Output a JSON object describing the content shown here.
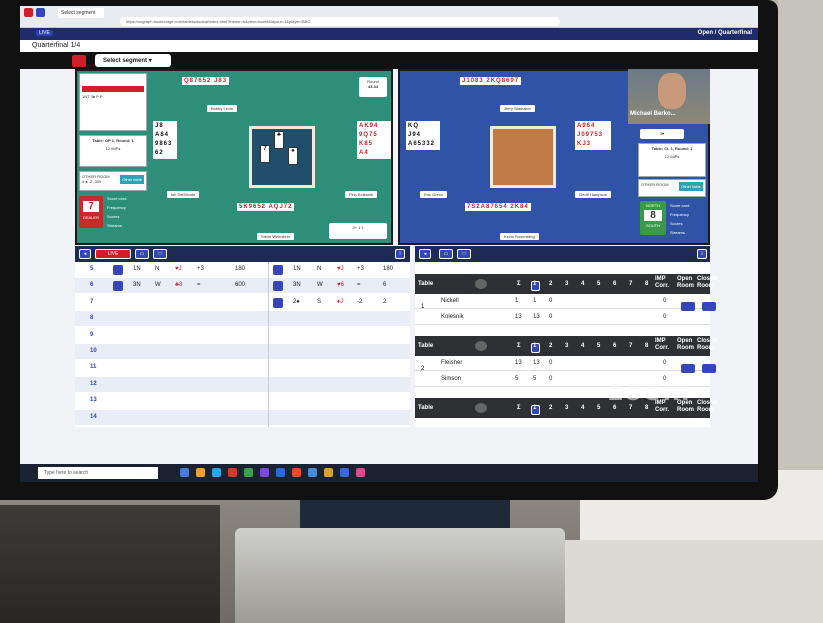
{
  "browser": {
    "tab_label": "Select segment",
    "url": "https://vugraph.bookbridge.com/tabletoolsdeal/index.html?theme=b&view=board&layout=1&player=BBO"
  },
  "topbar": {
    "live_label": "LIVE",
    "section_title": "Open / Quarterfinal",
    "event": "Quarterfinal 1/4"
  },
  "toolbar": {
    "segment_select": "Select segment"
  },
  "left_table": {
    "north_hand": "Q87652 J83",
    "north_name": "Bobby Levin",
    "west_name": "Ish Del'Monte",
    "east_name": "Finn Kolesnik",
    "south_name": "Steve Weinstein",
    "south_hand": "5K9652 AQJ72",
    "west_hand": [
      "J8",
      "A84",
      "9863",
      "62"
    ],
    "east_hand": [
      "AK94",
      "9Q75",
      "K85",
      "A4"
    ],
    "round_label": "Round",
    "round_time": "43:34",
    "table_info": "Table: OP 1, Round: 1",
    "imps": "12 IMPs",
    "other_room": "OTHER ROOM",
    "other_room_contract": "5 ♠ -2 -300",
    "other_table": "Other table",
    "dealer": "DEALER",
    "board_number": "7",
    "menu": [
      "Score card",
      "Frequency",
      "Scores",
      "Streams"
    ],
    "tricks": [
      "3+",
      "1",
      "1"
    ],
    "bid_grid": [
      "1NT",
      "3♠",
      "P",
      "P"
    ]
  },
  "right_table": {
    "north_hand": "J1083 2KQ8697",
    "north_name": "Jerry Stamatov",
    "west_name": "Eric Greco",
    "east_name": "Geoff Hampson",
    "south_name": "Kevin Rosenberg",
    "south_hand": "7S2A87654 2K84",
    "west_hand": [
      "KQ",
      "J94",
      "",
      "A65332"
    ],
    "east_hand": [
      "A964",
      "",
      "J09753",
      "KJ3"
    ],
    "table_info": "Table: CL 1, Round: 1",
    "imps": "12 IMPs",
    "other_room": "OTHER ROOM",
    "other_table": "Other table",
    "board_number": "8",
    "north_label": "NORTH",
    "south_label": "SOUTH",
    "menu": [
      "Score card",
      "Frequency",
      "Scores",
      "Streams"
    ],
    "bid": "3♥"
  },
  "video": {
    "participant": "Michael Berko..."
  },
  "boards": {
    "rows": [
      {
        "n": "5",
        "c1": "1N",
        "d1": "N",
        "s1": "♥J",
        "r1": "+3",
        "sc1": "180",
        "c2": "1N",
        "d2": "N",
        "s2": "♥J",
        "r2": "+3",
        "sc2": "180"
      },
      {
        "n": "6",
        "c1": "3N",
        "d1": "W",
        "s1": "♣8",
        "r1": "=",
        "sc1": "600",
        "c2": "3N",
        "d2": "W",
        "s2": "♥6",
        "r2": "=",
        "sc2": "6"
      },
      {
        "n": "7",
        "c1": "",
        "d1": "",
        "s1": "",
        "r1": "",
        "sc1": "",
        "c2": "2♠",
        "d2": "S",
        "s2": "♦J",
        "r2": "-2",
        "sc2": "2"
      },
      {
        "n": "8"
      },
      {
        "n": "9"
      },
      {
        "n": "10"
      },
      {
        "n": "11"
      },
      {
        "n": "12"
      },
      {
        "n": "13"
      },
      {
        "n": "14"
      }
    ]
  },
  "results": {
    "header_table": "Table",
    "header_sigma": "Σ",
    "cols": [
      "1",
      "2",
      "3",
      "4",
      "5",
      "6",
      "7",
      "8"
    ],
    "imp_corr": "IMP Corr.",
    "open_room": "Open Room",
    "closed_room": "Closed Room",
    "tables": [
      {
        "num": "1",
        "players": [
          {
            "name": "Nickell",
            "s": "1",
            "r": "1",
            "x": "0",
            "imp": "0"
          },
          {
            "name": "Kolesnik",
            "s": "13",
            "r": "13",
            "x": "0",
            "imp": "0"
          }
        ]
      },
      {
        "num": "2",
        "players": [
          {
            "name": "Fleisher",
            "s": "13",
            "r": "13",
            "x": "0",
            "imp": "0"
          },
          {
            "name": "Simson",
            "s": "5",
            "r": "5",
            "x": "0",
            "imp": "0"
          }
        ]
      }
    ]
  },
  "taskbar": {
    "search_placeholder": "Type here to search"
  },
  "zoom_watermark": "zoom"
}
